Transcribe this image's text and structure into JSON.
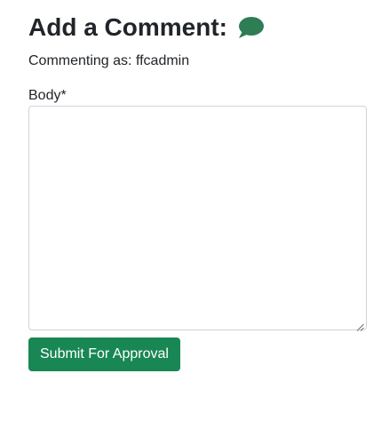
{
  "form": {
    "title": "Add a Comment:",
    "commenting_as": "Commenting as: ffcadmin",
    "body_label": "Body*",
    "body_value": "",
    "submit_label": "Submit For Approval"
  },
  "icons": {
    "title_icon": "speech-bubble-icon",
    "resize_grip": "resize-grip-icon"
  },
  "colors": {
    "accent": "#198754",
    "icon": "#2e7d55",
    "text": "#212529",
    "border": "#ced4da"
  }
}
